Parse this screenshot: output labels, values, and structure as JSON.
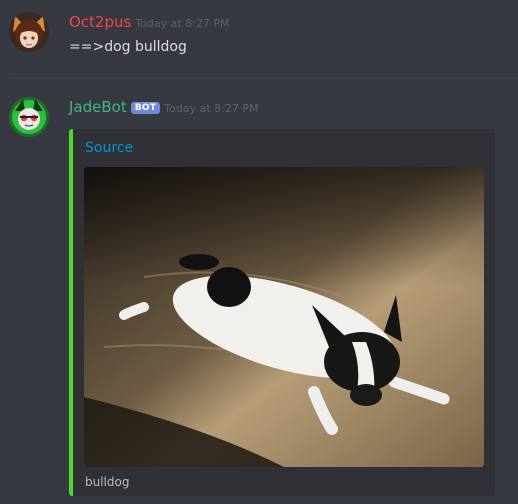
{
  "messages": [
    {
      "author": "Oct2pus",
      "author_color": "#f04747",
      "timestamp": "Today at 8:27 PM",
      "text": "==>dog bulldog"
    },
    {
      "author": "JadeBot",
      "author_color": "#43b581",
      "bot_badge": "BOT",
      "timestamp": "Today at 8:27 PM",
      "embed": {
        "accent_color": "#4fd829",
        "title": "Source",
        "image_alt": "bulldog",
        "footer": "bulldog"
      }
    }
  ],
  "colors": {
    "background": "#36393f",
    "embed_background": "#2f3136",
    "link": "#0096cf"
  }
}
